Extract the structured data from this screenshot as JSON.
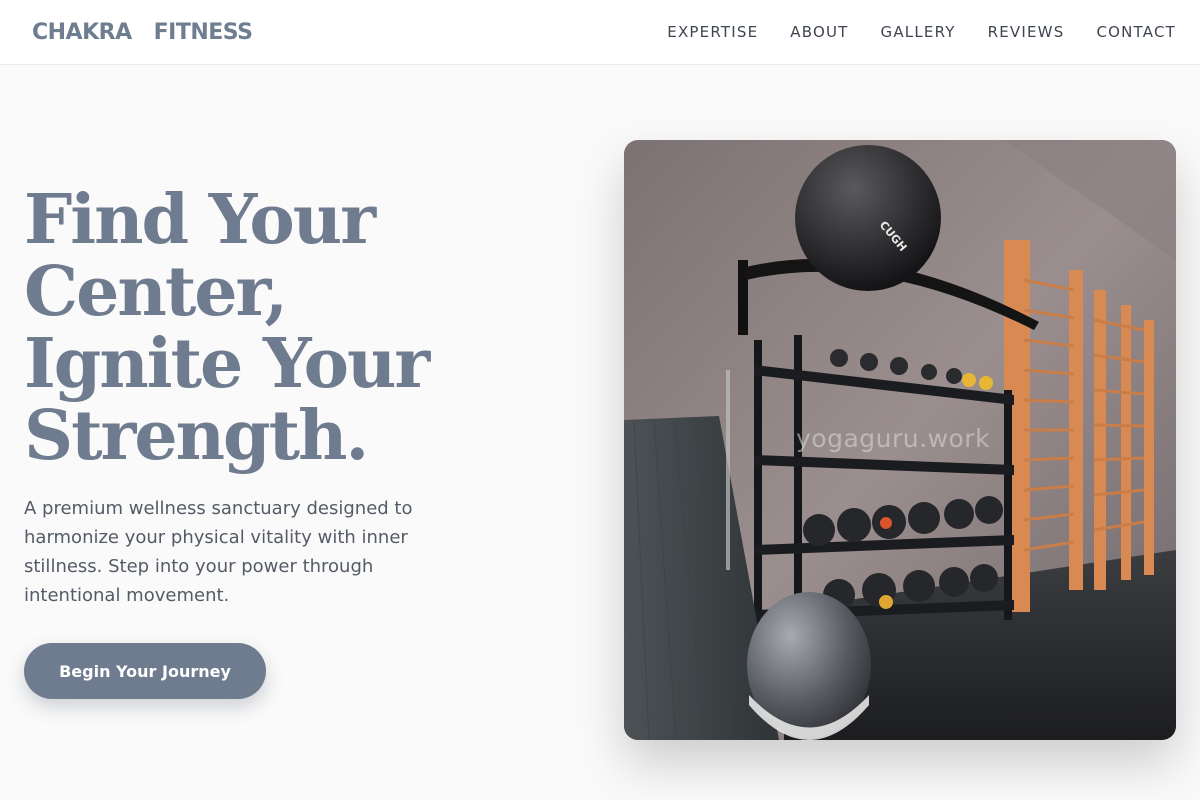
{
  "brand": {
    "part1": "CHAKRA",
    "part2": "FITNESS"
  },
  "nav": {
    "items": [
      "EXPERTISE",
      "ABOUT",
      "GALLERY",
      "REVIEWS",
      "CONTACT"
    ]
  },
  "hero": {
    "title_lines": [
      "Find Your",
      "Center,",
      "Ignite Your",
      "Strength."
    ],
    "description": "A premium wellness sanctuary designed to harmonize your physical vitality with inner stillness. Step into your power through intentional movement.",
    "cta_label": "Begin Your Journey"
  },
  "image": {
    "watermark": "yogaguru.work",
    "ball_label": "CUGH"
  },
  "colors": {
    "accent": "#6f7b8e",
    "text_dark": "#3f4550",
    "background": "#fafafa",
    "ladder_orange": "#d98a52"
  }
}
